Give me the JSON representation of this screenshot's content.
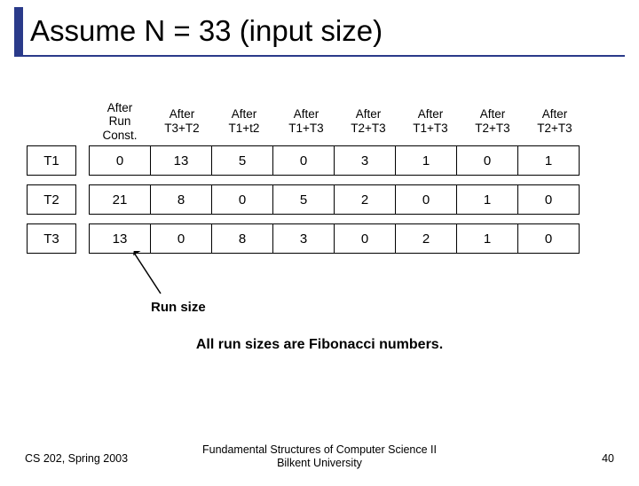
{
  "title": "Assume N = 33 (input size)",
  "row_labels": [
    "T1",
    "T2",
    "T3"
  ],
  "headers": [
    "After\nRun\nConst.",
    "After\nT3+T2",
    "After\nT1+t2",
    "After\nT1+T3",
    "After\nT2+T3",
    "After\nT1+T3",
    "After\nT2+T3",
    "After\nT2+T3"
  ],
  "rows": [
    [
      "0",
      "13",
      "5",
      "0",
      "3",
      "1",
      "0",
      "1"
    ],
    [
      "21",
      "8",
      "0",
      "5",
      "2",
      "0",
      "1",
      "0"
    ],
    [
      "13",
      "0",
      "8",
      "3",
      "0",
      "2",
      "1",
      "0"
    ]
  ],
  "runsize_label": "Run size",
  "fib_note": "All run sizes are Fibonacci numbers.",
  "footer": {
    "left": "CS 202, Spring 2003",
    "center_l1": "Fundamental Structures of Computer Science II",
    "center_l2": "Bilkent University",
    "right": "40"
  },
  "chart_data": {
    "type": "table",
    "title": "Assume N = 33 (input size)",
    "columns": [
      "After Run Const.",
      "After T3+T2",
      "After T1+t2",
      "After T1+T3",
      "After T2+T3",
      "After T1+T3",
      "After T2+T3",
      "After T2+T3"
    ],
    "row_labels": [
      "T1",
      "T2",
      "T3"
    ],
    "values": [
      [
        0,
        13,
        5,
        0,
        3,
        1,
        0,
        1
      ],
      [
        21,
        8,
        0,
        5,
        2,
        0,
        1,
        0
      ],
      [
        13,
        0,
        8,
        3,
        0,
        2,
        1,
        0
      ]
    ],
    "annotations": [
      "Run size",
      "All run sizes are Fibonacci numbers."
    ]
  }
}
